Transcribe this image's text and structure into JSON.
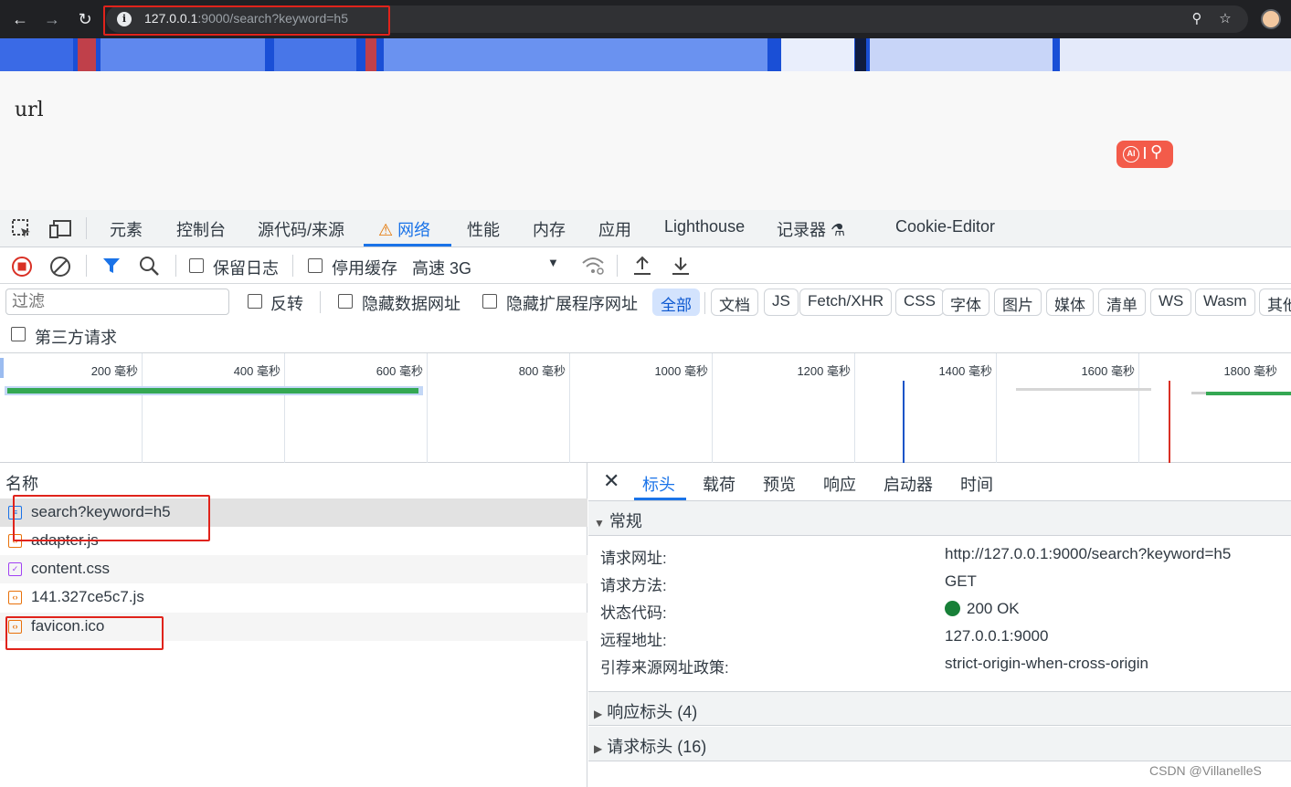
{
  "browser": {
    "url_host": "127.0.0.1",
    "url_rest": ":9000/search?keyword=h5"
  },
  "page": {
    "body_text": "url",
    "ai_label": "AI"
  },
  "devtools": {
    "tabs": [
      "元素",
      "控制台",
      "源代码/来源",
      "网络",
      "性能",
      "内存",
      "应用",
      "Lighthouse",
      "记录器",
      "Cookie-Editor"
    ],
    "active_tab": "网络",
    "toolbar": {
      "preserve_log": "保留日志",
      "disable_cache": "停用缓存",
      "throttle": "高速 3G"
    },
    "filter": {
      "placeholder": "过滤",
      "invert": "反转",
      "hide_data_urls": "隐藏数据网址",
      "hide_ext_urls": "隐藏扩展程序网址",
      "chips": [
        "全部",
        "文档",
        "JS",
        "Fetch/XHR",
        "CSS",
        "字体",
        "图片",
        "媒体",
        "清单",
        "WS",
        "Wasm",
        "其他"
      ],
      "third_party": "第三方请求"
    },
    "timeline": {
      "ticks": [
        "200 毫秒",
        "400 毫秒",
        "600 毫秒",
        "800 毫秒",
        "1000 毫秒",
        "1200 毫秒",
        "1400 毫秒",
        "1600 毫秒",
        "1800 毫秒"
      ]
    },
    "requests": {
      "header": "名称",
      "rows": [
        {
          "name": "search?keyword=h5",
          "type": "doc"
        },
        {
          "name": "adapter.js",
          "type": "script"
        },
        {
          "name": "content.css",
          "type": "css"
        },
        {
          "name": "141.327ce5c7.js",
          "type": "script"
        },
        {
          "name": "favicon.ico",
          "type": "script"
        }
      ]
    },
    "details": {
      "tabs": [
        "标头",
        "载荷",
        "预览",
        "响应",
        "启动器",
        "时间"
      ],
      "active_tab": "标头",
      "general_title": "常规",
      "general": [
        {
          "key": "请求网址:",
          "value": "http://127.0.0.1:9000/search?keyword=h5"
        },
        {
          "key": "请求方法:",
          "value": "GET"
        },
        {
          "key": "状态代码:",
          "value": "200 OK"
        },
        {
          "key": "远程地址:",
          "value": "127.0.0.1:9000"
        },
        {
          "key": "引荐来源网址政策:",
          "value": "strict-origin-when-cross-origin"
        }
      ],
      "response_headers": "响应标头 (4)",
      "request_headers": "请求标头 (16)"
    }
  },
  "watermark": "CSDN @VillanelleS",
  "colors": {
    "accent": "#1a73e8",
    "status_ok": "#188038",
    "highlight": "#e0231b"
  }
}
